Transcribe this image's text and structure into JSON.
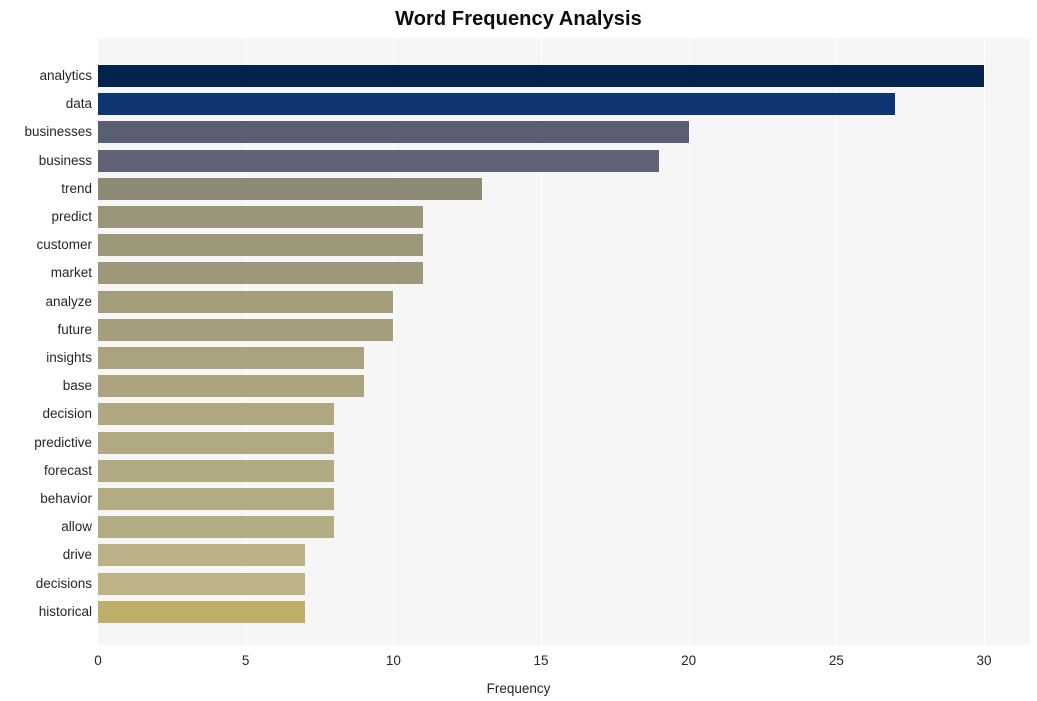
{
  "chart_data": {
    "type": "bar",
    "orientation": "horizontal",
    "title": "Word Frequency Analysis",
    "xlabel": "Frequency",
    "ylabel": "",
    "xlim": [
      0,
      30
    ],
    "xticks": [
      0,
      5,
      10,
      15,
      20,
      25,
      30
    ],
    "xtick_labels": [
      "0",
      "5",
      "10",
      "15",
      "20",
      "25",
      "30"
    ],
    "grid": true,
    "grid_axis": "x",
    "legend": false,
    "plot_background": "#f6f6f7",
    "figure_background": "#ffffff",
    "categories": [
      "analytics",
      "data",
      "businesses",
      "business",
      "trend",
      "predict",
      "customer",
      "market",
      "analyze",
      "future",
      "insights",
      "base",
      "decision",
      "predictive",
      "forecast",
      "behavior",
      "allow",
      "drive",
      "decisions",
      "historical"
    ],
    "values": [
      30,
      27,
      20,
      19,
      13,
      11,
      11,
      11,
      10,
      10,
      9,
      9,
      8,
      8,
      8,
      8,
      8,
      7,
      7,
      7
    ],
    "bar_colors": [
      "#03224c",
      "#0e3572",
      "#5b5f72",
      "#5f6375",
      "#8c8975",
      "#9b9679",
      "#9d977a",
      "#9e987a",
      "#a49d7c",
      "#a59e7c",
      "#aaa37e",
      "#aba47e",
      "#b0a881",
      "#b1a981",
      "#b2aa82",
      "#b3ab82",
      "#b4ac83",
      "#bcb287",
      "#bdb387",
      "#bfae68"
    ]
  }
}
